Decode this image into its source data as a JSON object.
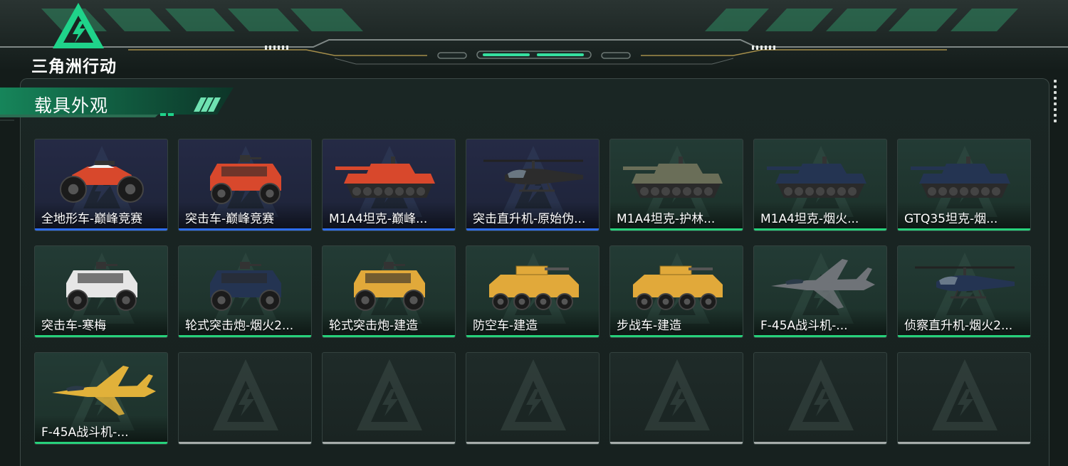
{
  "app": {
    "logo_text": "三角洲行动",
    "section_title": "载具外观"
  },
  "colors": {
    "rarity_blue": "#2e6df0",
    "rarity_green": "#27d17b",
    "empty_gray": "#a5acaa",
    "accent_green": "#1fd38a"
  },
  "items": [
    {
      "label": "全地形车-巅峰竞赛",
      "rarity": "blue",
      "icon": "atv-icon",
      "tint": "#d8482c"
    },
    {
      "label": "突击车-巅峰竞赛",
      "rarity": "blue",
      "icon": "assault-vehicle-icon",
      "tint": "#d8482c"
    },
    {
      "label": "M1A4坦克-巅峰...",
      "rarity": "blue",
      "icon": "tank-icon",
      "tint": "#d8482c"
    },
    {
      "label": "突击直升机-原始伪...",
      "rarity": "blue",
      "icon": "attack-helicopter-icon",
      "tint": "#2c2c2c"
    },
    {
      "label": "M1A4坦克-护林...",
      "rarity": "green",
      "icon": "tank-icon",
      "tint": "#6a6e58"
    },
    {
      "label": "M1A4坦克-烟火...",
      "rarity": "green",
      "icon": "tank-icon",
      "tint": "#243452"
    },
    {
      "label": "GTQ35坦克-烟...",
      "rarity": "green",
      "icon": "tank-icon",
      "tint": "#243452"
    },
    {
      "label": "突击车-寒梅",
      "rarity": "green",
      "icon": "assault-vehicle-icon",
      "tint": "#e6e6e6"
    },
    {
      "label": "轮式突击炮-烟火2...",
      "rarity": "green",
      "icon": "assault-vehicle-icon",
      "tint": "#243452"
    },
    {
      "label": "轮式突击炮-建造",
      "rarity": "green",
      "icon": "assault-vehicle-icon",
      "tint": "#e1a93a"
    },
    {
      "label": "防空车-建造",
      "rarity": "green",
      "icon": "apc-icon",
      "tint": "#e1a93a"
    },
    {
      "label": "步战车-建造",
      "rarity": "green",
      "icon": "apc-icon",
      "tint": "#e1a93a"
    },
    {
      "label": "F-45A战斗机-...",
      "rarity": "green",
      "icon": "fighter-jet-icon",
      "tint": "#6f7378"
    },
    {
      "label": "侦察直升机-烟火2...",
      "rarity": "green",
      "icon": "scout-helicopter-icon",
      "tint": "#243452"
    },
    {
      "label": "F-45A战斗机-...",
      "rarity": "green",
      "icon": "fighter-jet-icon",
      "tint": "#e1b13a"
    },
    {
      "label": "",
      "rarity": "empty",
      "icon": "delta-logo-icon"
    },
    {
      "label": "",
      "rarity": "empty",
      "icon": "delta-logo-icon"
    },
    {
      "label": "",
      "rarity": "empty",
      "icon": "delta-logo-icon"
    },
    {
      "label": "",
      "rarity": "empty",
      "icon": "delta-logo-icon"
    },
    {
      "label": "",
      "rarity": "empty",
      "icon": "delta-logo-icon"
    },
    {
      "label": "",
      "rarity": "empty",
      "icon": "delta-logo-icon"
    }
  ]
}
